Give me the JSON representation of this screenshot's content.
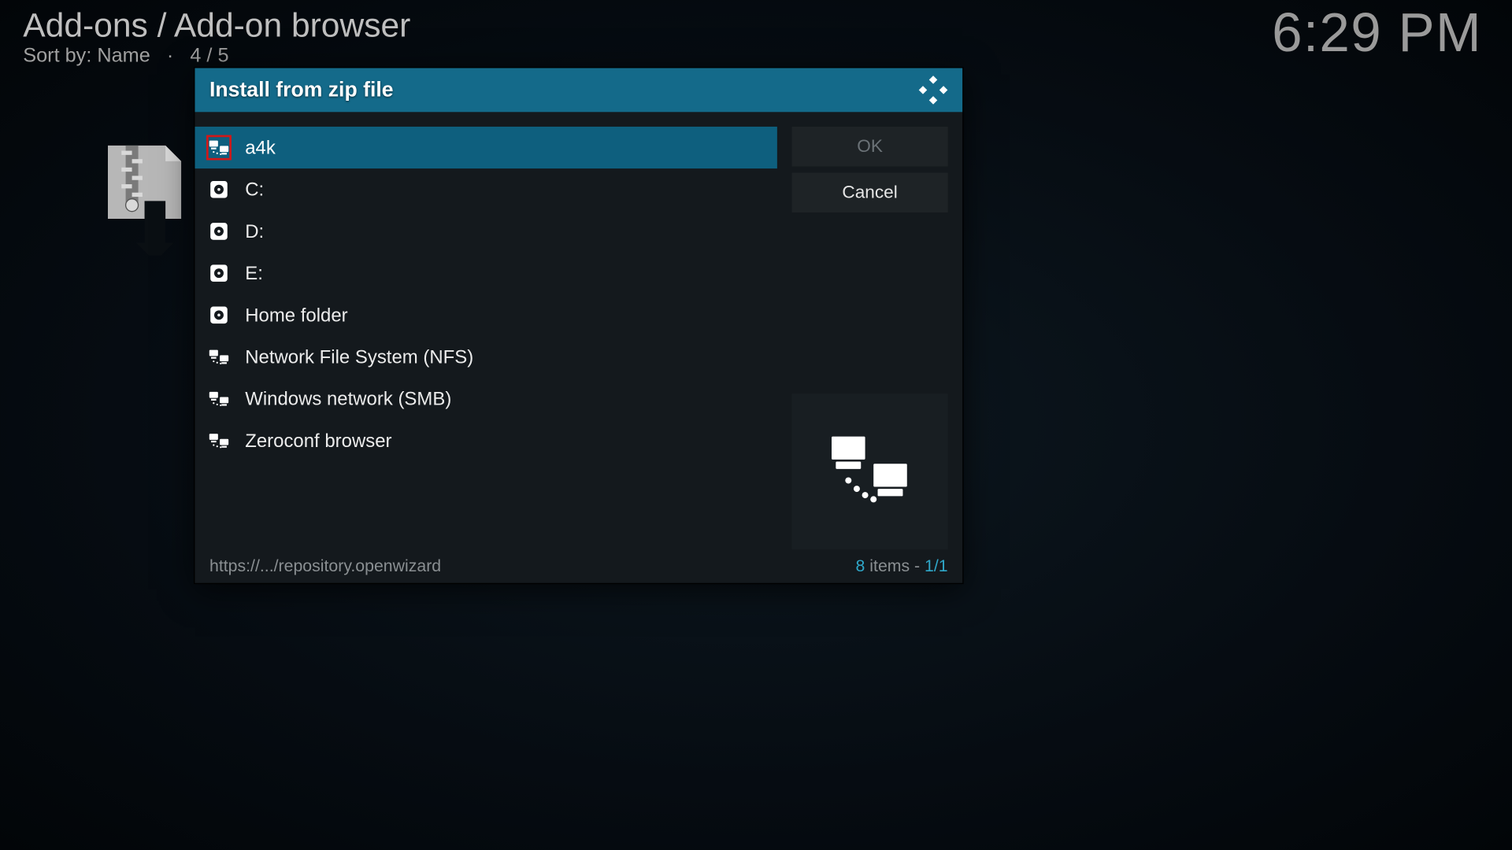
{
  "header": {
    "breadcrumb": "Add-ons / Add-on browser",
    "sort_label": "Sort by: Name",
    "position": "4 / 5",
    "clock": "6:29 PM"
  },
  "dialog": {
    "title": "Install from zip file",
    "items": [
      {
        "label": "a4k",
        "icon": "network",
        "selected": true,
        "highlight": true
      },
      {
        "label": "C:",
        "icon": "disk"
      },
      {
        "label": "D:",
        "icon": "disk"
      },
      {
        "label": "E:",
        "icon": "disk"
      },
      {
        "label": "Home folder",
        "icon": "disk"
      },
      {
        "label": "Network File System (NFS)",
        "icon": "network"
      },
      {
        "label": "Windows network (SMB)",
        "icon": "network"
      },
      {
        "label": "Zeroconf browser",
        "icon": "network"
      }
    ],
    "buttons": {
      "ok": "OK",
      "cancel": "Cancel"
    },
    "footer": {
      "path": "https://.../repository.openwizard",
      "count_n": "8",
      "count_items": " items - ",
      "count_page": "1/1"
    }
  }
}
